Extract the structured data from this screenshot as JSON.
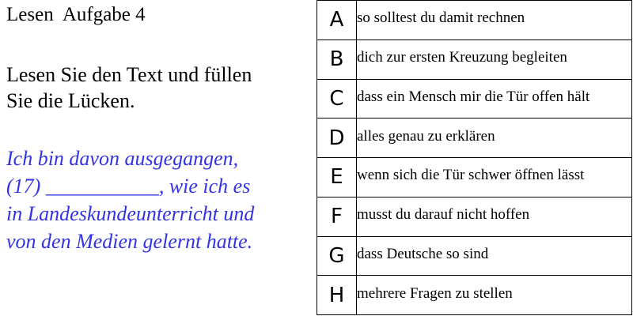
{
  "title": "Lesen  Aufgabe 4",
  "instruction": {
    "line1": "Lesen Sie den Text und füllen",
    "line2": "Sie die Lücken."
  },
  "sample_text": {
    "line1": "Ich bin davon ausgegangen,",
    "line2": "(17) ___________, wie ich es",
    "line3": "in Landeskundeunterricht und",
    "line4": "von den Medien gelernt hatte.",
    "color": "#3333e6"
  },
  "options": [
    {
      "letter": "A",
      "text": "so solltest du damit rechnen"
    },
    {
      "letter": "B",
      "text": "dich zur ersten Kreuzung begleiten"
    },
    {
      "letter": "C",
      "text": "dass ein Mensch mir die Tür offen hält"
    },
    {
      "letter": "D",
      "text": "alles genau zu erklären"
    },
    {
      "letter": "E",
      "text": "wenn sich die Tür schwer öffnen lässt"
    },
    {
      "letter": "F",
      "text": "musst du darauf nicht hoffen"
    },
    {
      "letter": "G",
      "text": "dass Deutsche so sind"
    },
    {
      "letter": "H",
      "text": "mehrere Fragen zu stellen"
    }
  ]
}
